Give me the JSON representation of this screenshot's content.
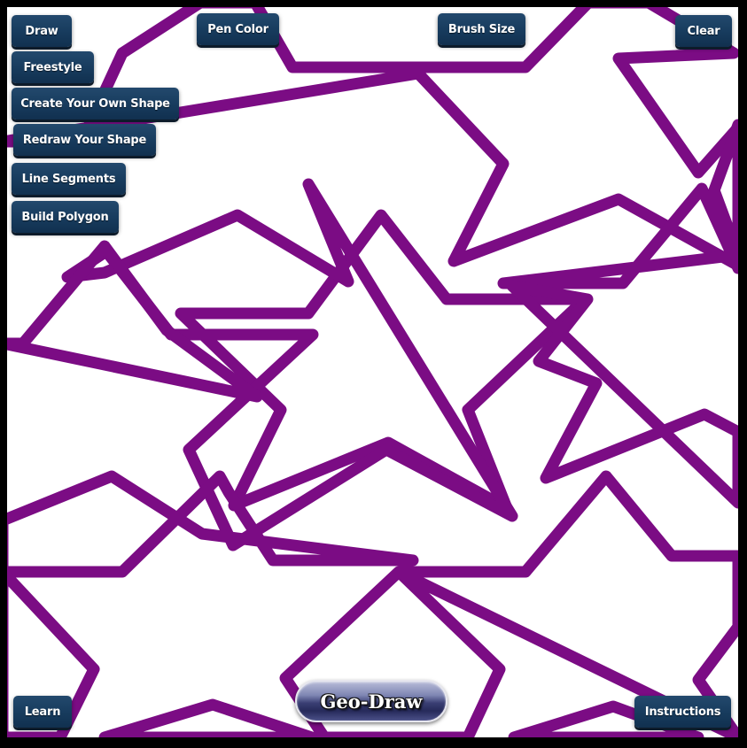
{
  "app": {
    "logo_label": "Geo-Draw"
  },
  "toolbar": {
    "draw": "Draw",
    "freestyle": "Freestyle",
    "create_shape": "Create Your Own Shape",
    "redraw_shape": "Redraw Your Shape",
    "line_segments": "Line Segments",
    "build_polygon": "Build Polygon",
    "pen_color": "Pen Color",
    "brush_size": "Brush Size",
    "clear": "Clear",
    "learn": "Learn",
    "instructions": "Instructions"
  },
  "canvas": {
    "background": "#ffffff",
    "stroke_color": "#7b0c84",
    "shape": "star"
  }
}
